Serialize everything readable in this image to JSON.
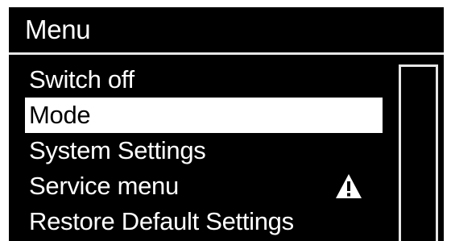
{
  "menu": {
    "title": "Menu",
    "selected_index": 1,
    "items": [
      {
        "label": "Switch off",
        "icon": null
      },
      {
        "label": "Mode",
        "icon": null
      },
      {
        "label": "System Settings",
        "icon": null
      },
      {
        "label": "Service menu",
        "icon": "warning-triangle-icon"
      },
      {
        "label": "Restore Default Settings",
        "icon": null
      }
    ]
  },
  "colors": {
    "background": "#000000",
    "foreground": "#ffffff",
    "selection_background": "#ffffff",
    "selection_text": "#000000"
  }
}
